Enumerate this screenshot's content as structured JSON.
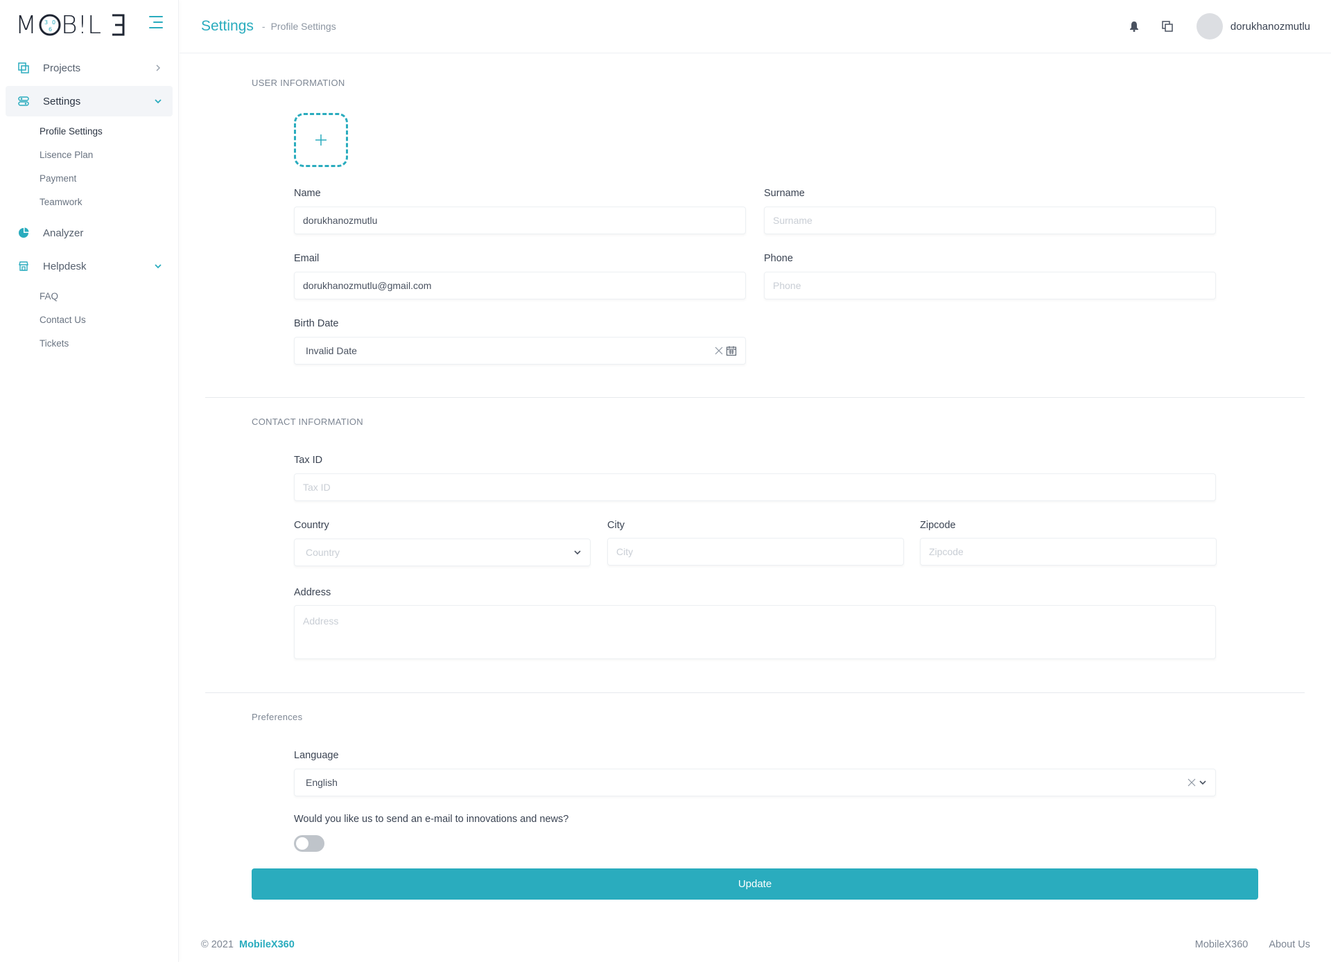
{
  "brand": {
    "logo_text": "MOBILE"
  },
  "sidebar": {
    "items": [
      {
        "label": "Projects"
      },
      {
        "label": "Settings",
        "sub": [
          "Profile Settings",
          "Lisence Plan",
          "Payment",
          "Teamwork"
        ]
      },
      {
        "label": "Analyzer"
      },
      {
        "label": "Helpdesk",
        "sub": [
          "FAQ",
          "Contact Us",
          "Tickets"
        ]
      }
    ]
  },
  "header": {
    "title": "Settings",
    "separator": "-",
    "breadcrumb": "Profile Settings",
    "username": "dorukhanozmutlu"
  },
  "user_info": {
    "title": "USER INFORMATION",
    "name": {
      "label": "Name",
      "value": "dorukhanozmutlu"
    },
    "surname": {
      "label": "Surname",
      "placeholder": "Surname"
    },
    "email": {
      "label": "Email",
      "value": "dorukhanozmutlu@gmail.com"
    },
    "phone": {
      "label": "Phone",
      "placeholder": "Phone"
    },
    "birth_date": {
      "label": "Birth Date",
      "value": "Invalid Date"
    }
  },
  "contact_info": {
    "title": "CONTACT INFORMATION",
    "tax_id": {
      "label": "Tax ID",
      "placeholder": "Tax ID"
    },
    "country": {
      "label": "Country",
      "placeholder": "Country"
    },
    "city": {
      "label": "City",
      "placeholder": "City"
    },
    "zipcode": {
      "label": "Zipcode",
      "placeholder": "Zipcode"
    },
    "address": {
      "label": "Address",
      "placeholder": "Address"
    }
  },
  "preferences": {
    "title": "Preferences",
    "language": {
      "label": "Language",
      "value": "English"
    },
    "newsletter": {
      "label": "Would you like us to send an e-mail to innovations and news?",
      "enabled": false
    }
  },
  "actions": {
    "update_label": "Update"
  },
  "footer": {
    "copyright": "© 2021",
    "brand": "MobileX360",
    "links": [
      "MobileX360",
      "About Us"
    ]
  },
  "colors": {
    "accent": "#2aacbe",
    "text": "#3b4453",
    "muted": "#7d8693"
  }
}
